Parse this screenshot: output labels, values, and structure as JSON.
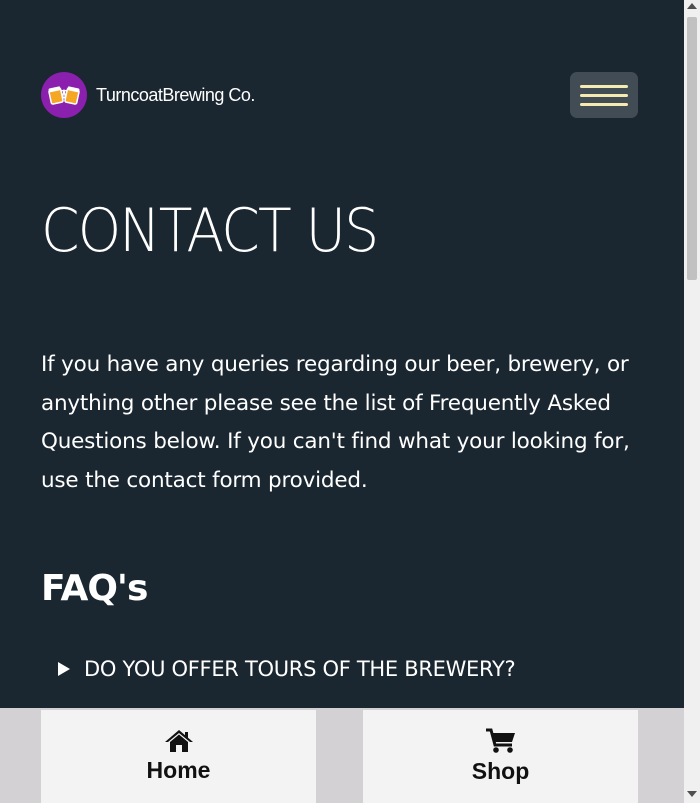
{
  "header": {
    "brand_name": "TurncoatBrewing Co.",
    "logo_icon": "beer-mugs-icon",
    "menu_icon": "hamburger-menu-icon"
  },
  "main": {
    "title": "CONTACT US",
    "intro": "If you have any queries regarding our beer, brewery, or anything other please see the list of Frequently Asked Questions below. If you can't find what your looking for, use the contact form provided.",
    "faq_title": "FAQ's",
    "faqs": [
      {
        "question": "DO YOU OFFER TOURS OF THE BREWERY?",
        "expanded": false
      }
    ]
  },
  "bottom_nav": {
    "items": [
      {
        "label": "Home",
        "icon": "home-icon"
      },
      {
        "label": "Shop",
        "icon": "shopping-cart-icon"
      }
    ]
  },
  "colors": {
    "background": "#1a2630",
    "menu_button": "#424c55",
    "menu_lines": "#f4eab2",
    "logo_badge": "#8b1fae",
    "nav_button": "#f3f3f3",
    "nav_bar": "#d3d1d3"
  }
}
